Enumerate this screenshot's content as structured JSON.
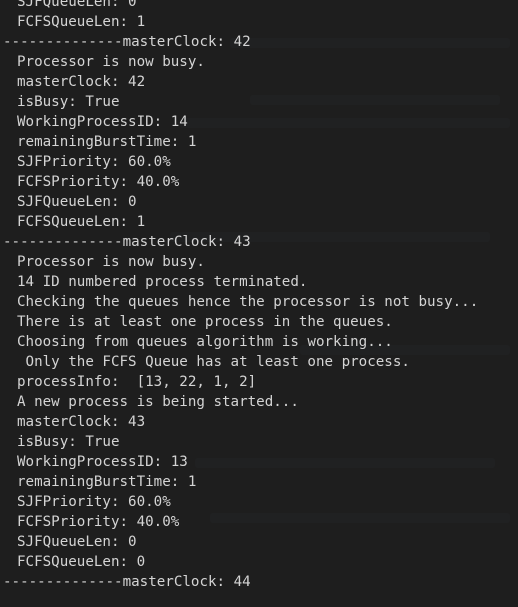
{
  "terminal": {
    "lines": [
      {
        "text": "SJFQueueLen: 0",
        "kind": "output"
      },
      {
        "text": "FCFSQueueLen: 1",
        "kind": "output"
      },
      {
        "text": "--------------masterClock: 42",
        "kind": "separator"
      },
      {
        "text": "Processor is now busy.",
        "kind": "output"
      },
      {
        "text": "masterClock: 42",
        "kind": "output"
      },
      {
        "text": "isBusy: True",
        "kind": "output"
      },
      {
        "text": "WorkingProcessID: 14",
        "kind": "output"
      },
      {
        "text": "remainingBurstTime: 1",
        "kind": "output"
      },
      {
        "text": "SJFPriority: 60.0%",
        "kind": "output"
      },
      {
        "text": "FCFSPriority: 40.0%",
        "kind": "output"
      },
      {
        "text": "SJFQueueLen: 0",
        "kind": "output"
      },
      {
        "text": "FCFSQueueLen: 1",
        "kind": "output"
      },
      {
        "text": "--------------masterClock: 43",
        "kind": "separator"
      },
      {
        "text": "Processor is now busy.",
        "kind": "output"
      },
      {
        "text": "14 ID numbered process terminated.",
        "kind": "output"
      },
      {
        "text": "Checking the queues hence the processor is not busy...",
        "kind": "output"
      },
      {
        "text": "There is at least one process in the queues.",
        "kind": "output"
      },
      {
        "text": "Choosing from queues algorithm is working...",
        "kind": "output"
      },
      {
        "text": " Only the FCFS Queue has at least one process.",
        "kind": "output"
      },
      {
        "text": "processInfo:  [13, 22, 1, 2]",
        "kind": "output"
      },
      {
        "text": "A new process is being started...",
        "kind": "output"
      },
      {
        "text": "masterClock: 43",
        "kind": "output"
      },
      {
        "text": "isBusy: True",
        "kind": "output"
      },
      {
        "text": "WorkingProcessID: 13",
        "kind": "output"
      },
      {
        "text": "remainingBurstTime: 1",
        "kind": "output"
      },
      {
        "text": "SJFPriority: 60.0%",
        "kind": "output"
      },
      {
        "text": "FCFSPriority: 40.0%",
        "kind": "output"
      },
      {
        "text": "SJFQueueLen: 0",
        "kind": "output"
      },
      {
        "text": "FCFSQueueLen: 0",
        "kind": "output"
      },
      {
        "text": "--------------masterClock: 44",
        "kind": "separator"
      },
      {
        "text": "                            ",
        "kind": "output"
      }
    ]
  },
  "colors": {
    "background": "#1e1e1e",
    "foreground": "#d4d4d4"
  }
}
